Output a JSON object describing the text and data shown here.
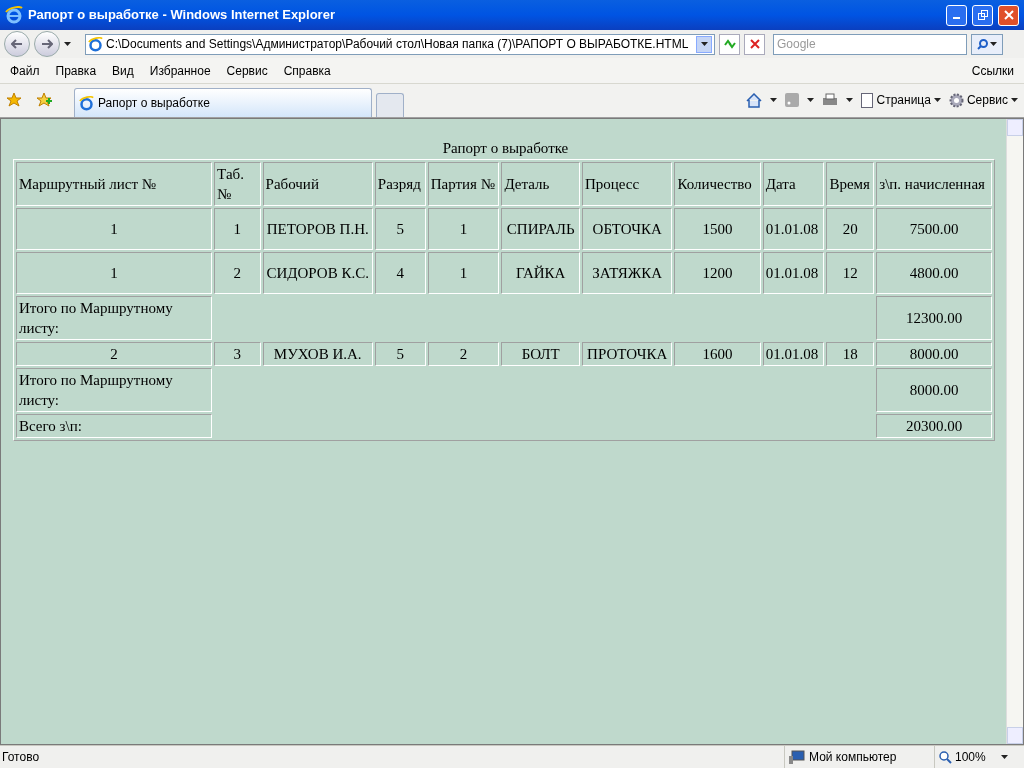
{
  "window": {
    "title": "Рапорт о выработке - Windows Internet Explorer"
  },
  "address_bar": {
    "value": "C:\\Documents and Settings\\Администратор\\Рабочий стол\\Новая папка (7)\\РАПОРТ О ВЫРАБОТКЕ.HTML"
  },
  "search": {
    "placeholder": "Google"
  },
  "menu": [
    "Файл",
    "Правка",
    "Вид",
    "Избранное",
    "Сервис",
    "Справка"
  ],
  "links_label": "Ссылки",
  "tabs": [
    {
      "label": "Рапорт о выработке",
      "selected": true
    }
  ],
  "toolbar": {
    "page": "Страница",
    "tools": "Сервис"
  },
  "page": {
    "title": "Рапорт о выработке",
    "table": {
      "columns": [
        "Маршрутный лист №",
        "Таб.№",
        "Рабочий",
        "Разряд",
        "Партия №",
        "Деталь",
        "Процесс",
        "Количество",
        "Дата",
        "Время",
        "з\\п. начисленная"
      ],
      "rows": [
        {
          "kind": "item",
          "cells": [
            "1",
            "1",
            "ПЕТОРОВ П.Н.",
            "5",
            "1",
            "СПИРАЛЬ",
            "ОБТОЧКА",
            "1500",
            "01.01.08",
            "20",
            "7500.00"
          ]
        },
        {
          "kind": "item",
          "cells": [
            "1",
            "2",
            "СИДОРОВ К.С.",
            "4",
            "1",
            "ГАЙКА",
            "ЗАТЯЖКА",
            "1200",
            "01.01.08",
            "12",
            "4800.00"
          ]
        },
        {
          "kind": "summary",
          "label": "Итого по Маршрутному листу:",
          "value": "12300.00"
        },
        {
          "kind": "item",
          "cells": [
            "2",
            "3",
            "МУХОВ И.А.",
            "5",
            "2",
            "БОЛТ",
            "ПРОТОЧКА",
            "1600",
            "01.01.08",
            "18",
            "8000.00"
          ]
        },
        {
          "kind": "summary",
          "label": "Итого по Маршрутному листу:",
          "value": "8000.00"
        },
        {
          "kind": "summary",
          "label": "Всего з\\п:",
          "value": "20300.00"
        }
      ]
    }
  },
  "status_bar": {
    "status": "Готово",
    "zone": "Мой компьютер",
    "zoom": "100%"
  }
}
